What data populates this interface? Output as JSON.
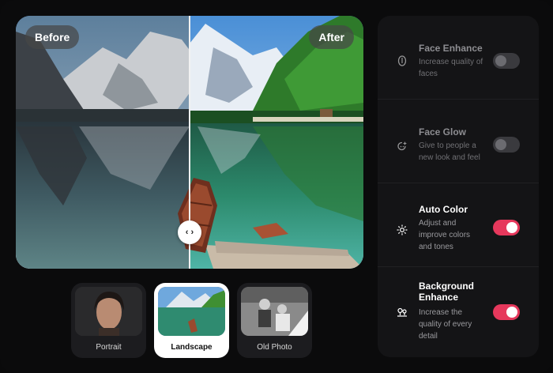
{
  "viewer": {
    "before_label": "Before",
    "after_label": "After",
    "handle_icon": "arrows-horizontal-icon",
    "split_fraction": 0.5
  },
  "presets": [
    {
      "label": "Portrait",
      "active": false
    },
    {
      "label": "Landscape",
      "active": true
    },
    {
      "label": "Old Photo",
      "active": false
    }
  ],
  "options": [
    {
      "title": "Face Enhance",
      "desc": "Increase quality of faces",
      "enabled": false,
      "icon": "face-outline-icon"
    },
    {
      "title": "Face Glow",
      "desc": "Give to people a new look and feel",
      "enabled": false,
      "icon": "glow-sparkle-icon"
    },
    {
      "title": "Auto Color",
      "desc": "Adjust and improve colors and tones",
      "enabled": true,
      "icon": "sun-icon"
    },
    {
      "title": "Background Enhance",
      "desc": "Increase the quality of every detail",
      "enabled": true,
      "icon": "landscape-icon"
    }
  ],
  "colors": {
    "accent": "#e6385c",
    "panel": "#141416",
    "background": "#0b0b0c"
  }
}
